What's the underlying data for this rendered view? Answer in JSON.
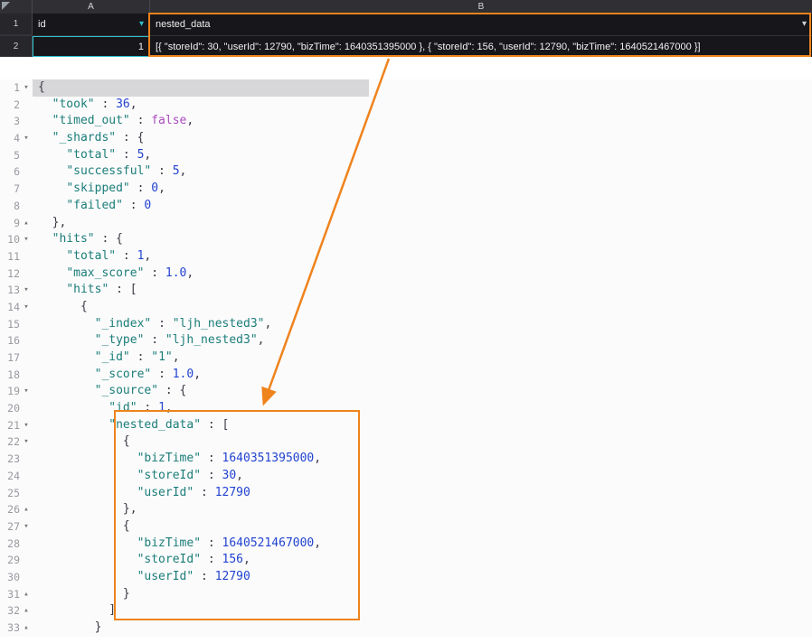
{
  "colors": {
    "annotation_orange": "#ef831c",
    "accent_teal": "#2fc1cd"
  },
  "icons": {
    "column_a_dropdown": "▾",
    "column_b_dropdown": "▾"
  },
  "grid": {
    "columns": [
      "A",
      "B"
    ],
    "rows": [
      {
        "num": "1",
        "a": "id",
        "b": "nested_data"
      },
      {
        "num": "2",
        "a": "1",
        "b": "[{ \"storeId\": 30, \"userId\": 12790, \"bizTime\": 1640351395000 }, { \"storeId\": 156, \"userId\": 12790, \"bizTime\": 1640521467000 }]"
      }
    ]
  },
  "editor": {
    "lines": [
      {
        "n": 1,
        "f": "open",
        "i": 0,
        "sel": true,
        "t": [
          [
            "p",
            "{"
          ]
        ]
      },
      {
        "n": 2,
        "f": null,
        "i": 2,
        "t": [
          [
            "k",
            "\"took\""
          ],
          [
            "p",
            " : "
          ],
          [
            "n",
            "36"
          ],
          [
            "p",
            ","
          ]
        ]
      },
      {
        "n": 3,
        "f": null,
        "i": 2,
        "t": [
          [
            "k",
            "\"timed_out\""
          ],
          [
            "p",
            " : "
          ],
          [
            "b",
            "false"
          ],
          [
            "p",
            ","
          ]
        ]
      },
      {
        "n": 4,
        "f": "open",
        "i": 2,
        "t": [
          [
            "k",
            "\"_shards\""
          ],
          [
            "p",
            " : {"
          ]
        ]
      },
      {
        "n": 5,
        "f": null,
        "i": 4,
        "t": [
          [
            "k",
            "\"total\""
          ],
          [
            "p",
            " : "
          ],
          [
            "n",
            "5"
          ],
          [
            "p",
            ","
          ]
        ]
      },
      {
        "n": 6,
        "f": null,
        "i": 4,
        "t": [
          [
            "k",
            "\"successful\""
          ],
          [
            "p",
            " : "
          ],
          [
            "n",
            "5"
          ],
          [
            "p",
            ","
          ]
        ]
      },
      {
        "n": 7,
        "f": null,
        "i": 4,
        "t": [
          [
            "k",
            "\"skipped\""
          ],
          [
            "p",
            " : "
          ],
          [
            "n",
            "0"
          ],
          [
            "p",
            ","
          ]
        ]
      },
      {
        "n": 8,
        "f": null,
        "i": 4,
        "t": [
          [
            "k",
            "\"failed\""
          ],
          [
            "p",
            " : "
          ],
          [
            "n",
            "0"
          ]
        ]
      },
      {
        "n": 9,
        "f": "end",
        "i": 2,
        "t": [
          [
            "p",
            "},"
          ]
        ]
      },
      {
        "n": 10,
        "f": "open",
        "i": 2,
        "t": [
          [
            "k",
            "\"hits\""
          ],
          [
            "p",
            " : {"
          ]
        ]
      },
      {
        "n": 11,
        "f": null,
        "i": 4,
        "t": [
          [
            "k",
            "\"total\""
          ],
          [
            "p",
            " : "
          ],
          [
            "n",
            "1"
          ],
          [
            "p",
            ","
          ]
        ]
      },
      {
        "n": 12,
        "f": null,
        "i": 4,
        "t": [
          [
            "k",
            "\"max_score\""
          ],
          [
            "p",
            " : "
          ],
          [
            "n",
            "1.0"
          ],
          [
            "p",
            ","
          ]
        ]
      },
      {
        "n": 13,
        "f": "open",
        "i": 4,
        "t": [
          [
            "k",
            "\"hits\""
          ],
          [
            "p",
            " : ["
          ]
        ]
      },
      {
        "n": 14,
        "f": "open",
        "i": 6,
        "t": [
          [
            "p",
            "{"
          ]
        ]
      },
      {
        "n": 15,
        "f": null,
        "i": 8,
        "t": [
          [
            "k",
            "\"_index\""
          ],
          [
            "p",
            " : "
          ],
          [
            "s",
            "\"ljh_nested3\""
          ],
          [
            "p",
            ","
          ]
        ]
      },
      {
        "n": 16,
        "f": null,
        "i": 8,
        "t": [
          [
            "k",
            "\"_type\""
          ],
          [
            "p",
            " : "
          ],
          [
            "s",
            "\"ljh_nested3\""
          ],
          [
            "p",
            ","
          ]
        ]
      },
      {
        "n": 17,
        "f": null,
        "i": 8,
        "t": [
          [
            "k",
            "\"_id\""
          ],
          [
            "p",
            " : "
          ],
          [
            "s",
            "\"1\""
          ],
          [
            "p",
            ","
          ]
        ]
      },
      {
        "n": 18,
        "f": null,
        "i": 8,
        "t": [
          [
            "k",
            "\"_score\""
          ],
          [
            "p",
            " : "
          ],
          [
            "n",
            "1.0"
          ],
          [
            "p",
            ","
          ]
        ]
      },
      {
        "n": 19,
        "f": "open",
        "i": 8,
        "t": [
          [
            "k",
            "\"_source\""
          ],
          [
            "p",
            " : {"
          ]
        ]
      },
      {
        "n": 20,
        "f": null,
        "i": 10,
        "t": [
          [
            "k",
            "\"id\""
          ],
          [
            "p",
            " : "
          ],
          [
            "n",
            "1"
          ],
          [
            "p",
            ","
          ]
        ]
      },
      {
        "n": 21,
        "f": "open",
        "i": 10,
        "t": [
          [
            "k",
            "\"nested_data\""
          ],
          [
            "p",
            " : ["
          ]
        ]
      },
      {
        "n": 22,
        "f": "open",
        "i": 12,
        "t": [
          [
            "p",
            "{"
          ]
        ]
      },
      {
        "n": 23,
        "f": null,
        "i": 14,
        "t": [
          [
            "k",
            "\"bizTime\""
          ],
          [
            "p",
            " : "
          ],
          [
            "n",
            "1640351395000"
          ],
          [
            "p",
            ","
          ]
        ]
      },
      {
        "n": 24,
        "f": null,
        "i": 14,
        "t": [
          [
            "k",
            "\"storeId\""
          ],
          [
            "p",
            " : "
          ],
          [
            "n",
            "30"
          ],
          [
            "p",
            ","
          ]
        ]
      },
      {
        "n": 25,
        "f": null,
        "i": 14,
        "t": [
          [
            "k",
            "\"userId\""
          ],
          [
            "p",
            " : "
          ],
          [
            "n",
            "12790"
          ]
        ]
      },
      {
        "n": 26,
        "f": "end",
        "i": 12,
        "t": [
          [
            "p",
            "},"
          ]
        ]
      },
      {
        "n": 27,
        "f": "open",
        "i": 12,
        "t": [
          [
            "p",
            "{"
          ]
        ]
      },
      {
        "n": 28,
        "f": null,
        "i": 14,
        "t": [
          [
            "k",
            "\"bizTime\""
          ],
          [
            "p",
            " : "
          ],
          [
            "n",
            "1640521467000"
          ],
          [
            "p",
            ","
          ]
        ]
      },
      {
        "n": 29,
        "f": null,
        "i": 14,
        "t": [
          [
            "k",
            "\"storeId\""
          ],
          [
            "p",
            " : "
          ],
          [
            "n",
            "156"
          ],
          [
            "p",
            ","
          ]
        ]
      },
      {
        "n": 30,
        "f": null,
        "i": 14,
        "t": [
          [
            "k",
            "\"userId\""
          ],
          [
            "p",
            " : "
          ],
          [
            "n",
            "12790"
          ]
        ]
      },
      {
        "n": 31,
        "f": "end",
        "i": 12,
        "t": [
          [
            "p",
            "}"
          ]
        ]
      },
      {
        "n": 32,
        "f": "end",
        "i": 10,
        "t": [
          [
            "p",
            "]"
          ]
        ]
      },
      {
        "n": 33,
        "f": "end",
        "i": 8,
        "t": [
          [
            "p",
            "}"
          ]
        ]
      }
    ]
  }
}
